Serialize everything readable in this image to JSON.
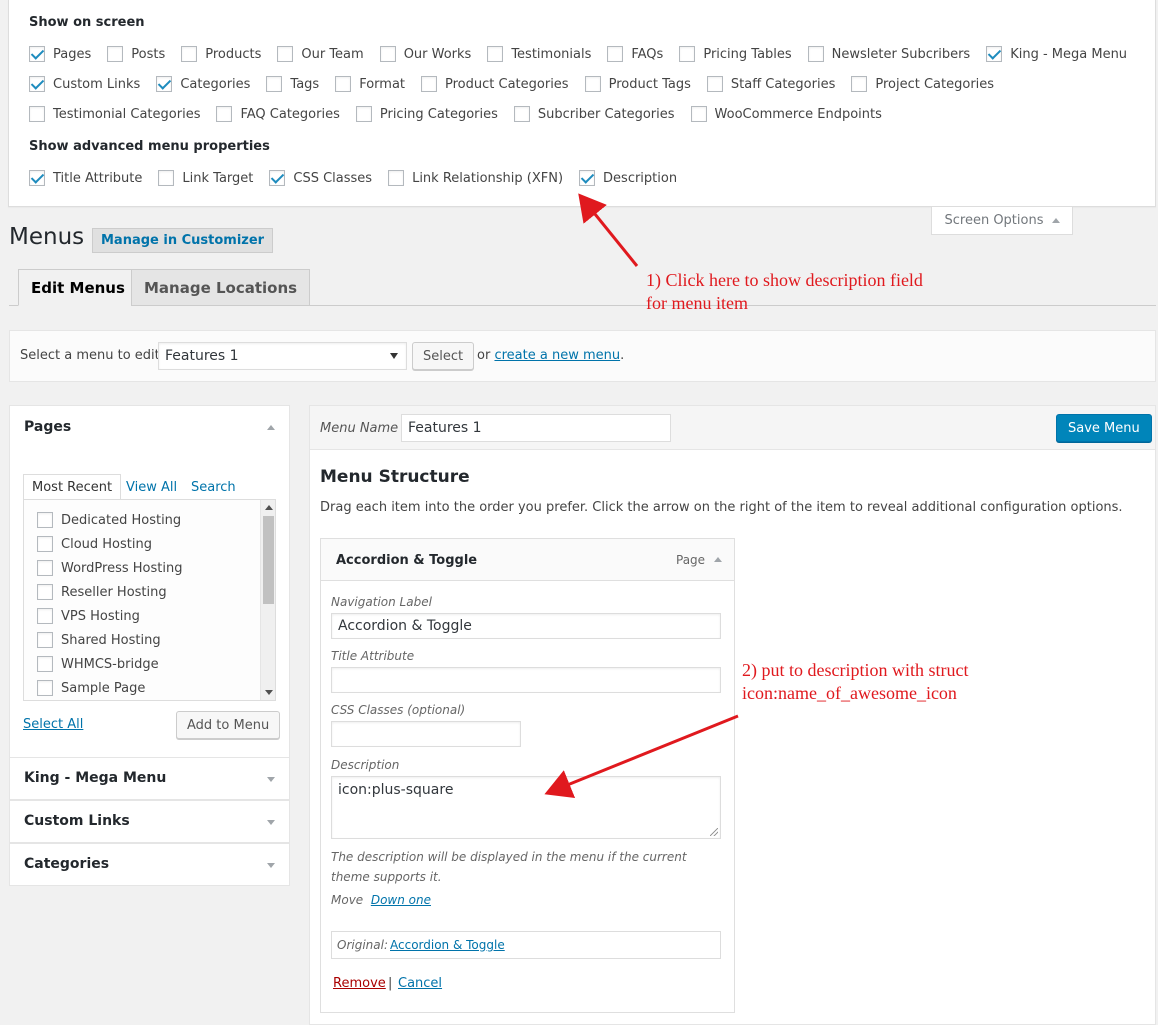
{
  "screen_options": {
    "heading": "Show on screen",
    "boxes": [
      [
        {
          "label": "Pages",
          "checked": true
        },
        {
          "label": "Posts",
          "checked": false
        },
        {
          "label": "Products",
          "checked": false
        },
        {
          "label": "Our Team",
          "checked": false
        },
        {
          "label": "Our Works",
          "checked": false
        },
        {
          "label": "Testimonials",
          "checked": false
        },
        {
          "label": "FAQs",
          "checked": false
        },
        {
          "label": "Pricing Tables",
          "checked": false
        },
        {
          "label": "Newsleter Subcribers",
          "checked": false
        },
        {
          "label": "King - Mega Menu",
          "checked": true
        }
      ],
      [
        {
          "label": "Custom Links",
          "checked": true
        },
        {
          "label": "Categories",
          "checked": true
        },
        {
          "label": "Tags",
          "checked": false
        },
        {
          "label": "Format",
          "checked": false
        },
        {
          "label": "Product Categories",
          "checked": false
        },
        {
          "label": "Product Tags",
          "checked": false
        },
        {
          "label": "Staff Categories",
          "checked": false
        },
        {
          "label": "Project Categories",
          "checked": false
        }
      ],
      [
        {
          "label": "Testimonial Categories",
          "checked": false
        },
        {
          "label": "FAQ Categories",
          "checked": false
        },
        {
          "label": "Pricing Categories",
          "checked": false
        },
        {
          "label": "Subcriber Categories",
          "checked": false
        },
        {
          "label": "WooCommerce Endpoints",
          "checked": false
        }
      ]
    ],
    "advanced_heading": "Show advanced menu properties",
    "advanced": [
      {
        "label": "Title Attribute",
        "checked": true
      },
      {
        "label": "Link Target",
        "checked": false
      },
      {
        "label": "CSS Classes",
        "checked": true
      },
      {
        "label": "Link Relationship (XFN)",
        "checked": false
      },
      {
        "label": "Description",
        "checked": true
      }
    ],
    "tab_label": "Screen Options"
  },
  "header": {
    "title": "Menus",
    "customizer_button": "Manage in Customizer"
  },
  "tabs": {
    "edit": "Edit Menus",
    "manage": "Manage Locations"
  },
  "select_bar": {
    "label": "Select a menu to edit:",
    "selected": "Features 1",
    "button": "Select",
    "or_text": "or",
    "create_link": "create a new menu",
    "period": "."
  },
  "sidebar": {
    "pages": {
      "title": "Pages",
      "tabs": [
        "Most Recent",
        "View All",
        "Search"
      ],
      "items": [
        "Dedicated Hosting",
        "Cloud Hosting",
        "WordPress Hosting",
        "Reseller Hosting",
        "VPS Hosting",
        "Shared Hosting",
        "WHMCS-bridge",
        "Sample Page"
      ],
      "select_all": "Select All",
      "add_button": "Add to Menu"
    },
    "sections": [
      "King - Mega Menu",
      "Custom Links",
      "Categories"
    ]
  },
  "menu": {
    "name_label": "Menu Name",
    "name_value": "Features 1",
    "save_button": "Save Menu",
    "structure_title": "Menu Structure",
    "instructions": "Drag each item into the order you prefer. Click the arrow on the right of the item to reveal additional configuration options.",
    "item": {
      "title": "Accordion & Toggle",
      "type": "Page",
      "nav_label_label": "Navigation Label",
      "nav_label_value": "Accordion & Toggle",
      "title_attr_label": "Title Attribute",
      "title_attr_value": "",
      "css_label": "CSS Classes (optional)",
      "css_value": "",
      "description_label": "Description",
      "description_value": "icon:plus-square",
      "description_help": "The description will be displayed in the menu if the current theme supports it.",
      "move_label": "Move",
      "move_link": "Down one",
      "original_label": "Original:",
      "original_link": "Accordion & Toggle",
      "remove": "Remove",
      "separator": "|",
      "cancel": "Cancel"
    }
  },
  "annotations": {
    "note1_line1": "1) Click here to show description field",
    "note1_line2": "for menu item",
    "note2_line1": "2) put to description with struct",
    "note2_line2": "icon:name_of_awesome_icon",
    "color": "#e0191e"
  }
}
